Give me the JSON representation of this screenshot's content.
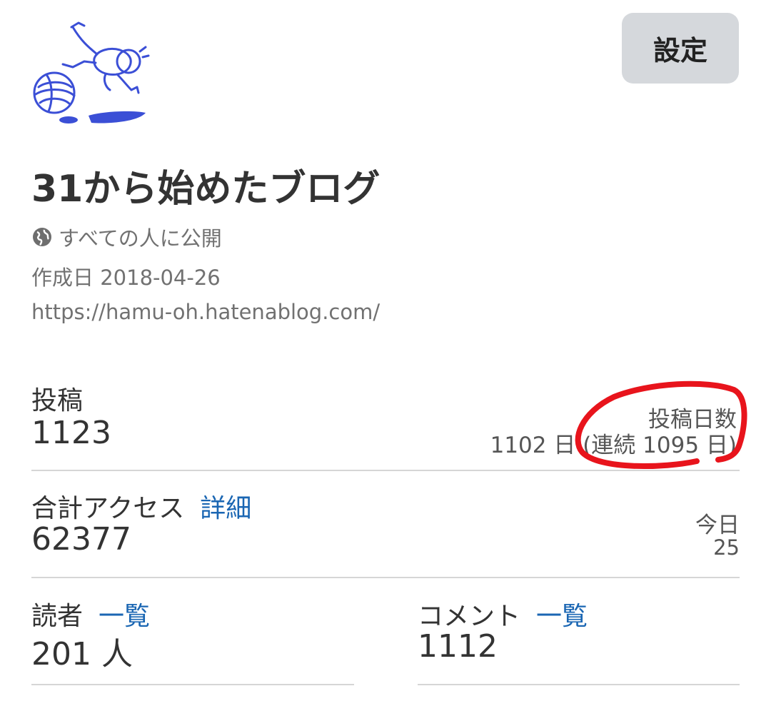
{
  "header": {
    "settings_label": "設定"
  },
  "blog": {
    "title": "31から始めたブログ",
    "visibility": "すべての人に公開",
    "created": "作成日 2018-04-26",
    "url": "https://hamu-oh.hatenablog.com/"
  },
  "stats": {
    "posts": {
      "label": "投稿",
      "value": "1123",
      "days_label": "投稿日数",
      "days_value": "1102 日 (連続 1095 日)"
    },
    "access": {
      "label": "合計アクセス",
      "link": "詳細",
      "value": "62377",
      "today_label": "今日",
      "today_value": "25"
    },
    "readers": {
      "label": "読者",
      "link": "一覧",
      "value": "201 人"
    },
    "comments": {
      "label": "コメント",
      "link": "一覧",
      "value": "1112"
    }
  },
  "colors": {
    "accent_link": "#1a66b3",
    "logo_blue": "#3b4fd6",
    "annotation_red": "#e8141c",
    "button_bg": "#d5d8dc"
  },
  "icons": {
    "logo": "hamster-ball-logo",
    "visibility": "globe-icon"
  }
}
